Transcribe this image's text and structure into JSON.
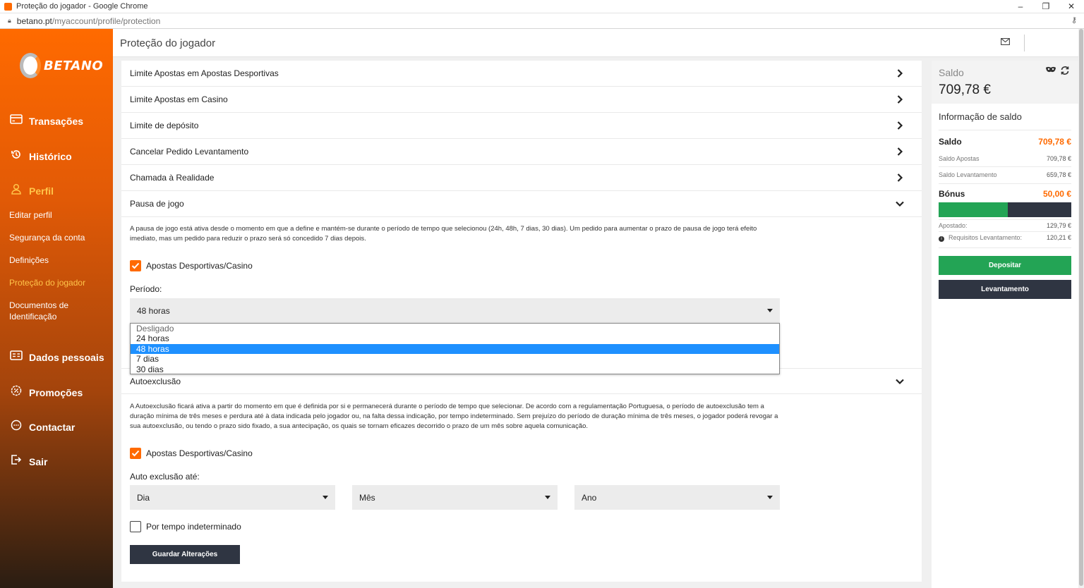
{
  "window": {
    "title": "Proteção do jogador - Google Chrome",
    "controls": [
      "–",
      "❐",
      "✕"
    ],
    "url_host": "betano.pt",
    "url_path": "/myaccount/profile/protection"
  },
  "brand": {
    "name": "BETANO",
    "accent": "#ff6a00"
  },
  "sidebar": {
    "main_items": [
      {
        "label": "Transações",
        "icon": "card-icon"
      },
      {
        "label": "Histórico",
        "icon": "history-icon"
      },
      {
        "label": "Perfil",
        "icon": "user-icon"
      },
      {
        "label": "Dados pessoais",
        "icon": "id-card-icon"
      },
      {
        "label": "Promoções",
        "icon": "percent-badge-icon"
      },
      {
        "label": "Contactar",
        "icon": "chat-icon"
      },
      {
        "label": "Sair",
        "icon": "logout-icon"
      }
    ],
    "sub_items": [
      {
        "label": "Editar perfil"
      },
      {
        "label": "Segurança da conta"
      },
      {
        "label": "Definições"
      },
      {
        "label": "Proteção do jogador"
      },
      {
        "label": "Documentos de Identificação"
      }
    ]
  },
  "header": {
    "title": "Proteção do jogador"
  },
  "main": {
    "accordion": [
      {
        "label": "Limite Apostas em Apostas Desportivas"
      },
      {
        "label": "Limite Apostas em Casino"
      },
      {
        "label": "Limite de depósito"
      },
      {
        "label": "Cancelar Pedido Levantamento"
      },
      {
        "label": "Chamada à Realidade"
      },
      {
        "label": "Pausa de jogo"
      },
      {
        "label": "Autoexclusão"
      }
    ],
    "pause": {
      "description": "A pausa de jogo está ativa desde o momento em que a define e mantém-se durante o período de tempo que selecionou (24h, 48h, 7 dias, 30 dias). Um pedido para aumentar o prazo de pausa de jogo terá efeito imediato, mas um pedido para reduzir o prazo será só concedido 7 dias depois.",
      "checkbox_label": "Apostas Desportivas/Casino",
      "period_label": "Período:",
      "period_value": "48 horas",
      "options": [
        "Desligado",
        "24 horas",
        "48 horas",
        "7 dias",
        "30 dias"
      ]
    },
    "self_exclusion": {
      "description": "A Autoexclusão ficará ativa a partir do momento em que é definida por si e permanecerá durante o período de tempo que selecionar. De acordo com a regulamentação Portuguesa, o período de autoexclusão tem a duração mínima de três meses e perdura até à data indicada pelo jogador ou, na falta dessa indicação, por tempo indeterminado. Sem prejuízo do período de duração mínima de três meses, o jogador poderá revogar a sua autoexclusão, ou tendo o prazo sido fixado, a sua antecipação, os quais se tornam eficazes decorrido o prazo de um mês sobre aquela comunicação.",
      "checkbox_label": "Apostas Desportivas/Casino",
      "until_label": "Auto exclusão até:",
      "day": "Dia",
      "month": "Mês",
      "year": "Ano",
      "indefinite_label": "Por tempo indeterminado"
    },
    "save_label": "Guardar Alterações"
  },
  "balance": {
    "label": "Saldo",
    "amount": "709,78 €",
    "info_title": "Informação de saldo",
    "saldo_label": "Saldo",
    "saldo_value": "709,78 €",
    "apostas_label": "Saldo Apostas",
    "apostas_value": "709,78 €",
    "levantamento_label": "Saldo Levantamento",
    "levantamento_value": "659,78 €",
    "bonus_label": "Bónus",
    "bonus_value": "50,00 €",
    "bonus_progress": 0.52,
    "apostado_label": "Apostado:",
    "apostado_value": "129,79 €",
    "requisitos_label": "Requisitos Levantamento:",
    "requisitos_value": "120,21 €",
    "deposit_label": "Depositar",
    "withdraw_label": "Levantamento",
    "colors": {
      "green": "#23a455",
      "dark": "#2f3542",
      "orange": "#ff6a00"
    }
  }
}
